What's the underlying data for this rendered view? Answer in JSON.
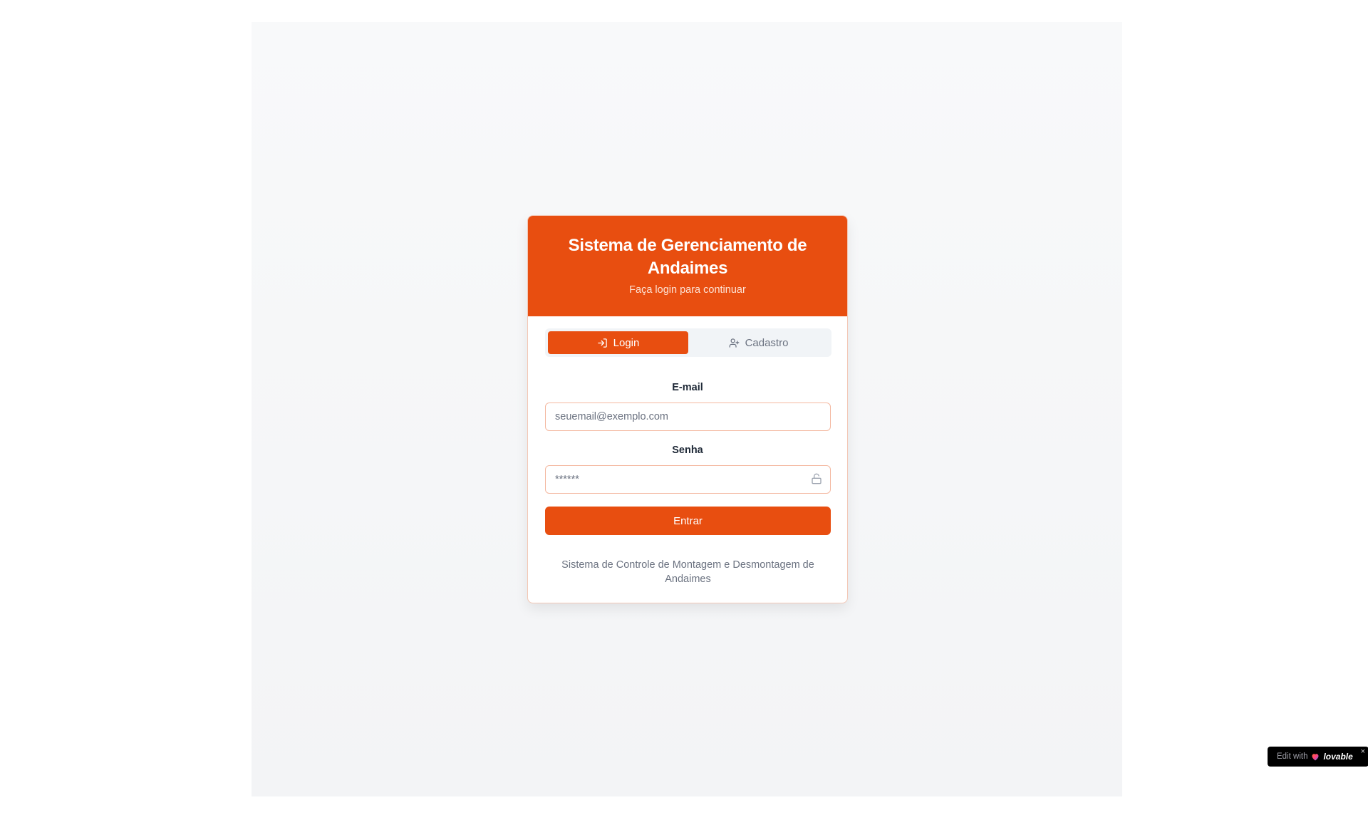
{
  "header": {
    "title": "Sistema de Gerenciamento de Andaimes",
    "subtitle": "Faça login para continuar"
  },
  "tabs": [
    {
      "label": "Login",
      "icon": "log-in-icon",
      "active": true
    },
    {
      "label": "Cadastro",
      "icon": "user-plus-icon",
      "active": false
    }
  ],
  "form": {
    "email": {
      "label": "E-mail",
      "placeholder": "seuemail@exemplo.com",
      "value": ""
    },
    "password": {
      "label": "Senha",
      "placeholder": "******",
      "value": "",
      "icon": "lock-icon"
    },
    "submit_label": "Entrar"
  },
  "footer": {
    "text": "Sistema de Controle de Montagem e Desmontagem de Andaimes"
  },
  "badge": {
    "prefix": "Edit with",
    "brand": "lovable",
    "close": "×"
  },
  "colors": {
    "accent": "#e84e10",
    "page_background": "#f8f9fa",
    "muted_text": "#6b7280"
  }
}
